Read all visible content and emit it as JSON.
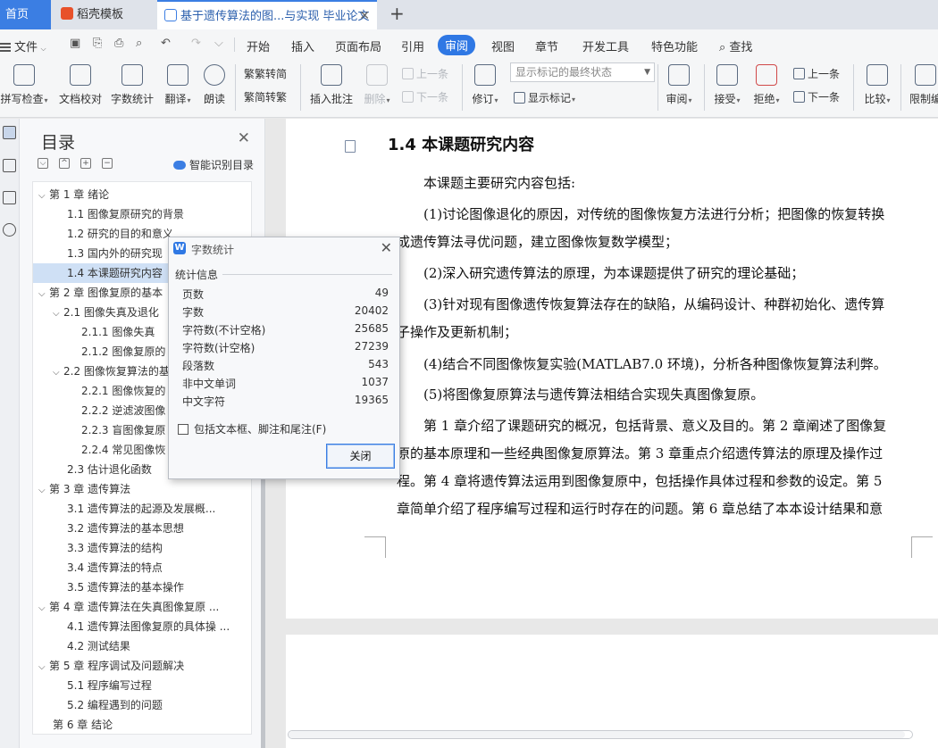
{
  "tabs": {
    "home": "首页",
    "template": "稻壳模板",
    "document": "基于遗传算法的图...与实现 毕业论文"
  },
  "menu": {
    "file": "文件",
    "items": [
      "开始",
      "插入",
      "页面布局",
      "引用",
      "审阅",
      "视图",
      "章节",
      "开发工具",
      "特色功能"
    ],
    "active": "审阅",
    "search": "查找"
  },
  "ribbon": {
    "spell": "拼写检查",
    "proofread": "文档校对",
    "wordcount": "字数统计",
    "translate": "翻译",
    "read": "朗读",
    "trad": "繁转简",
    "simp": "简转繁",
    "insert_comment": "插入批注",
    "delete": "删除",
    "prev1": "上一条",
    "next1": "下一条",
    "revise": "修订",
    "display_select": "显示标记的最终状态",
    "show_markup": "显示标记",
    "review": "审阅",
    "accept": "接受",
    "reject": "拒绝",
    "prev2": "上一条",
    "next2": "下一条",
    "compare": "比较",
    "restrict": "限制编"
  },
  "toc": {
    "title": "目录",
    "smart": "智能识别目录",
    "items": [
      {
        "text": "第 1 章  绪论",
        "level": 0,
        "arrow": "⌵"
      },
      {
        "text": "1.1   图像复原研究的背景",
        "level": 1,
        "arrow": ""
      },
      {
        "text": "1.2   研究的目的和意义",
        "level": 1,
        "arrow": ""
      },
      {
        "text": "1.3   国内外的研究现",
        "level": 1,
        "arrow": ""
      },
      {
        "text": "1.4   本课题研究内容",
        "level": 1,
        "arrow": ""
      },
      {
        "text": "第 2 章  图像复原的基本",
        "level": 0,
        "arrow": "⌵"
      },
      {
        "text": "2.1   图像失真及退化",
        "level": 1,
        "arrow": "⌵"
      },
      {
        "text": "2.1.1  图像失真",
        "level": 2,
        "arrow": ""
      },
      {
        "text": "2.1.2  图像复原的",
        "level": 2,
        "arrow": ""
      },
      {
        "text": "2.2 图像恢复算法的基",
        "level": 1,
        "arrow": "⌵"
      },
      {
        "text": "2.2.1   图像恢复的",
        "level": 2,
        "arrow": ""
      },
      {
        "text": "2.2.2   逆滤波图像",
        "level": 2,
        "arrow": ""
      },
      {
        "text": "2.2.3   盲图像复原",
        "level": 2,
        "arrow": ""
      },
      {
        "text": "2.2.4 常见图像恢",
        "level": 2,
        "arrow": ""
      },
      {
        "text": "2.3   估计退化函数",
        "level": 1,
        "arrow": ""
      },
      {
        "text": "第 3 章  遗传算法",
        "level": 0,
        "arrow": "⌵"
      },
      {
        "text": "3.1   遗传算法的起源及发展概...",
        "level": 1,
        "arrow": ""
      },
      {
        "text": "3.2   遗传算法的基本思想",
        "level": 1,
        "arrow": ""
      },
      {
        "text": "3.3   遗传算法的结构",
        "level": 1,
        "arrow": ""
      },
      {
        "text": "3.4 遗传算法的特点",
        "level": 1,
        "arrow": ""
      },
      {
        "text": "3.5 遗传算法的基本操作",
        "level": 1,
        "arrow": ""
      },
      {
        "text": "第 4 章  遗传算法在失真图像复原 ...",
        "level": 0,
        "arrow": "⌵"
      },
      {
        "text": "4.1 遗传算法图像复原的具体操 ...",
        "level": 1,
        "arrow": ""
      },
      {
        "text": "4.2  测试结果",
        "level": 1,
        "arrow": ""
      },
      {
        "text": "第 5 章  程序调试及问题解决",
        "level": 0,
        "arrow": "⌵"
      },
      {
        "text": "5.1  程序编写过程",
        "level": 1,
        "arrow": ""
      },
      {
        "text": "5.2  编程遇到的问题",
        "level": 1,
        "arrow": ""
      },
      {
        "text": "第 6 章  结论",
        "level": 0,
        "arrow": ""
      }
    ],
    "highlighted_index": 4
  },
  "document": {
    "heading": "1.4   本课题研究内容",
    "lines": [
      "本课题主要研究内容包括:",
      "(1)讨论图像退化的原因，对传统的图像恢复方法进行分析；把图像的恢复转换",
      "成遗传算法寻优问题，建立图像恢复数学模型；",
      "(2)深入研究遗传算法的原理，为本课题提供了研究的理论基础；",
      "(3)针对现有图像遗传恢复算法存在的缺陷，从编码设计、种群初始化、遗传算",
      "子操作及更新机制；",
      "(4)结合不同图像恢复实验(MATLAB7.0 环境)，分析各种图像恢复算法利弊。",
      "(5)将图像复原算法与遗传算法相结合实现失真图像复原。",
      "第 1 章介绍了课题研究的概况，包括背景、意义及目的。第 2 章阐述了图像复",
      "原的基本原理和一些经典图像复原算法。第 3 章重点介绍遗传算法的原理及操作过",
      "程。第 4 章将遗传算法运用到图像复原中，包括操作具体过程和参数的设定。第 5",
      "章简单介绍了程序编写过程和运行时存在的问题。第 6 章总结了本本设计结果和意"
    ]
  },
  "dialog": {
    "title": "字数统计",
    "group": "统计信息",
    "stats": [
      {
        "label": "页数",
        "value": "49"
      },
      {
        "label": "字数",
        "value": "20402"
      },
      {
        "label": "字符数(不计空格)",
        "value": "25685"
      },
      {
        "label": "字符数(计空格)",
        "value": "27239"
      },
      {
        "label": "段落数",
        "value": "543"
      },
      {
        "label": "非中文单词",
        "value": "1037"
      },
      {
        "label": "中文字符",
        "value": "19365"
      }
    ],
    "checkbox": "包括文本框、脚注和尾注(F)",
    "close_button": "关闭"
  },
  "colors": {
    "accent": "#2f78e4",
    "toc_highlight": "#cfe0f5"
  }
}
